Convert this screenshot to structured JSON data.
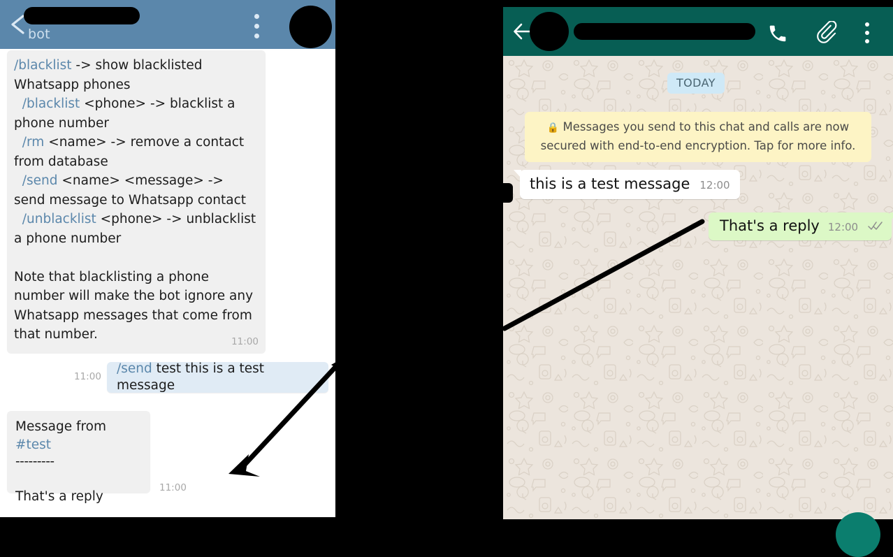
{
  "telegram": {
    "header": {
      "back_icon": "back-chevron-icon",
      "title_redacted": true,
      "subtitle": "bot",
      "menu_icon": "overflow-menu-icon",
      "avatar_redacted": true,
      "bg_color": "#5b87ab"
    },
    "messages": [
      {
        "id": "help-message",
        "direction": "incoming",
        "segments": [
          {
            "type": "command",
            "text": "/blacklist"
          },
          {
            "type": "plain",
            "text": " -> show blacklisted Whatsapp phones\n  "
          },
          {
            "type": "command",
            "text": "/blacklist"
          },
          {
            "type": "plain",
            "text": " <phone> -> blacklist a phone number\n  "
          },
          {
            "type": "command",
            "text": "/rm"
          },
          {
            "type": "plain",
            "text": " <name> -> remove a contact from database\n  "
          },
          {
            "type": "command",
            "text": "/send"
          },
          {
            "type": "plain",
            "text": " <name> <message> -> send message to Whatsapp contact\n  "
          },
          {
            "type": "command",
            "text": "/unblacklist"
          },
          {
            "type": "plain",
            "text": " <phone> -> unblacklist a phone number\n\nNote that blacklisting a phone number will make the bot ignore any Whatsapp messages that come from that number."
          }
        ],
        "time": "11:00"
      },
      {
        "id": "send-command",
        "direction": "outgoing",
        "command": "/send",
        "text": " test this is a test message",
        "time": "11:00"
      },
      {
        "id": "forwarded-reply",
        "direction": "incoming",
        "line1_prefix": "Message from ",
        "line1_tag": "#test",
        "line2": "---------",
        "line3": "That's a reply",
        "time": "11:00"
      }
    ]
  },
  "whatsapp": {
    "header": {
      "back_icon": "back-arrow-icon",
      "avatar_redacted": true,
      "title_redacted": true,
      "call_icon": "phone-call-icon",
      "attach_icon": "paperclip-icon",
      "menu_icon": "overflow-menu-icon",
      "bg_color": "#075e54"
    },
    "day_divider": "TODAY",
    "encryption_notice": "Messages you send to this chat and calls are now secured with end-to-end encryption. Tap for more info.",
    "lock_icon": "lock-icon",
    "messages": [
      {
        "id": "incoming-test",
        "direction": "incoming",
        "text": "this is a test message",
        "time": "12:00",
        "bubble_color": "#ffffff"
      },
      {
        "id": "outgoing-reply",
        "direction": "outgoing",
        "text": "That's a reply",
        "time": "12:00",
        "status": "delivered-double-check",
        "bubble_color": "#dcf8c6"
      }
    ],
    "fab_icon": "new-chat-fab",
    "fab_color": "#0b7e6e"
  },
  "annotations": {
    "arrow_left": {
      "name": "arrow-telegram-send-to-reply",
      "color": "#000000"
    },
    "arrow_right": {
      "name": "arrow-whatsapp-to-reply-bubble",
      "color": "#000000"
    }
  }
}
